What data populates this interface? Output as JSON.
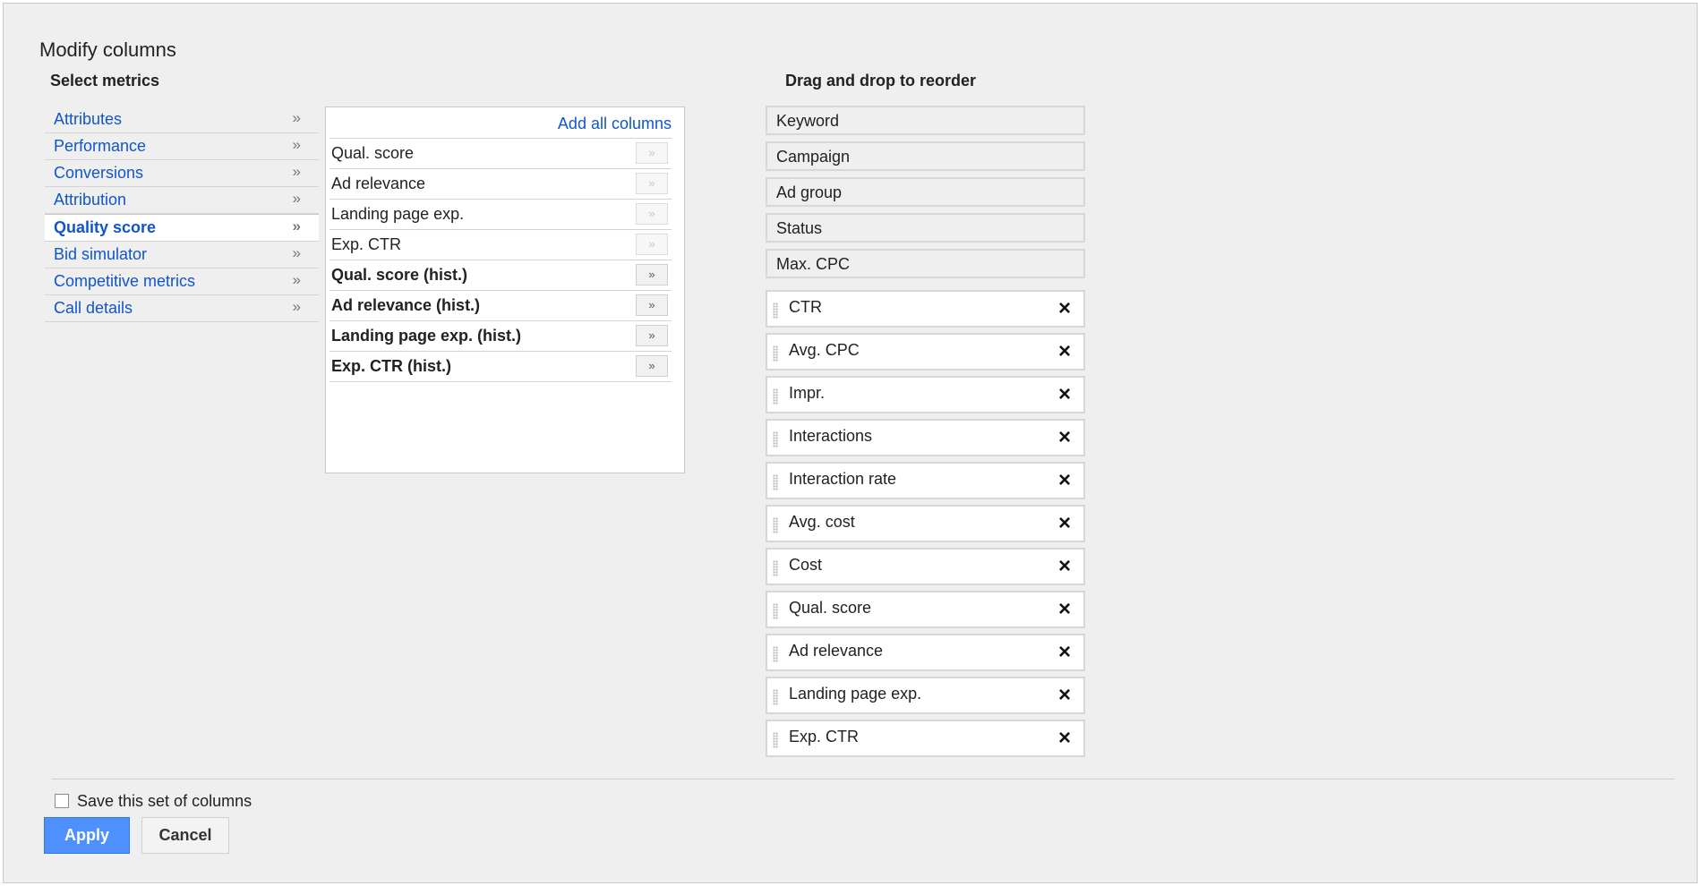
{
  "dialog": {
    "title": "Modify columns"
  },
  "select_metrics": {
    "heading": "Select metrics",
    "categories": [
      {
        "label": "Attributes",
        "chevron": "»"
      },
      {
        "label": "Performance",
        "chevron": "»"
      },
      {
        "label": "Conversions",
        "chevron": "»"
      },
      {
        "label": "Attribution",
        "chevron": "»"
      },
      {
        "label": "Quality score",
        "chevron": "»",
        "selected": true
      },
      {
        "label": "Bid simulator",
        "chevron": "»"
      },
      {
        "label": "Competitive metrics",
        "chevron": "»"
      },
      {
        "label": "Call details",
        "chevron": "»"
      }
    ]
  },
  "metrics_panel": {
    "add_all_label": "Add all columns",
    "rows": [
      {
        "label": "Qual. score",
        "button": "»",
        "added": true
      },
      {
        "label": "Ad relevance",
        "button": "»",
        "added": true
      },
      {
        "label": "Landing page exp.",
        "button": "»",
        "added": true
      },
      {
        "label": "Exp. CTR",
        "button": "»",
        "added": true
      },
      {
        "label": "Qual. score (hist.)",
        "button": "»",
        "added": false
      },
      {
        "label": "Ad relevance (hist.)",
        "button": "»",
        "added": false
      },
      {
        "label": "Landing page exp. (hist.)",
        "button": "»",
        "added": false
      },
      {
        "label": "Exp. CTR (hist.)",
        "button": "»",
        "added": false
      }
    ]
  },
  "reorder": {
    "heading": "Drag and drop to reorder",
    "fixed_columns": [
      "Keyword",
      "Campaign",
      "Ad group",
      "Status",
      "Max. CPC"
    ],
    "movable_columns": [
      "CTR",
      "Avg. CPC",
      "Impr.",
      "Interactions",
      "Interaction rate",
      "Avg. cost",
      "Cost",
      "Qual. score",
      "Ad relevance",
      "Landing page exp.",
      "Exp. CTR"
    ],
    "remove_icon": "×"
  },
  "footer": {
    "save_label": "Save this set of columns",
    "save_checked": false,
    "apply_label": "Apply",
    "cancel_label": "Cancel"
  },
  "colors": {
    "link": "#1155cc",
    "apply_bg": "#4d90fe",
    "dialog_bg": "#efefef"
  }
}
